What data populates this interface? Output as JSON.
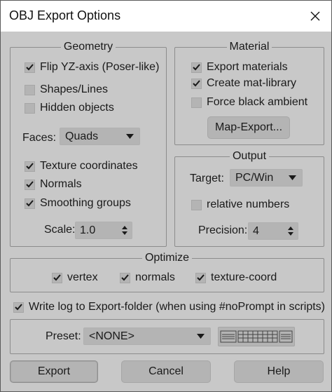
{
  "window": {
    "title": "OBJ Export Options",
    "close_glyph": "✕"
  },
  "geometry": {
    "title": "Geometry",
    "flip_yz": {
      "label": "Flip YZ-axis (Poser-like)",
      "checked": true
    },
    "shapes_lines": {
      "label": "Shapes/Lines",
      "checked": false
    },
    "hidden_objects": {
      "label": "Hidden objects",
      "checked": false
    },
    "faces_label": "Faces:",
    "faces_value": "Quads",
    "texture_coords": {
      "label": "Texture coordinates",
      "checked": true
    },
    "normals": {
      "label": "Normals",
      "checked": true
    },
    "smoothing_groups": {
      "label": "Smoothing groups",
      "checked": true
    },
    "scale_label": "Scale:",
    "scale_value": "1.0"
  },
  "material": {
    "title": "Material",
    "export_materials": {
      "label": "Export materials",
      "checked": true
    },
    "create_mat_library": {
      "label": "Create mat-library",
      "checked": true
    },
    "force_black_ambient": {
      "label": "Force black ambient",
      "checked": false
    },
    "map_export_label": "Map-Export..."
  },
  "output": {
    "title": "Output",
    "target_label": "Target:",
    "target_value": "PC/Win",
    "relative_numbers": {
      "label": "relative numbers",
      "checked": false
    },
    "precision_label": "Precision:",
    "precision_value": "4"
  },
  "optimize": {
    "title": "Optimize",
    "vertex": {
      "label": "vertex",
      "checked": true
    },
    "normals": {
      "label": "normals",
      "checked": true
    },
    "texture_coord": {
      "label": "texture-coord",
      "checked": true
    }
  },
  "write_log": {
    "label": "Write log to Export-folder (when using #noPrompt in scripts)",
    "checked": true
  },
  "preset": {
    "label": "Preset:",
    "value": "<NONE>"
  },
  "buttons": {
    "export": "Export",
    "cancel": "Cancel",
    "help": "Help"
  },
  "icons": {
    "checkmark": "checkmark-icon",
    "dropdown_arrow": "triangle-down-icon",
    "spinner": "spinner-arrows-icon",
    "preset_manager": "preset-manager-icon",
    "close": "close-icon"
  },
  "colors": {
    "panel": "#c8c8c8",
    "control": "#b4b4b4",
    "border": "#8c8c8c",
    "text": "#1a1a1a"
  }
}
